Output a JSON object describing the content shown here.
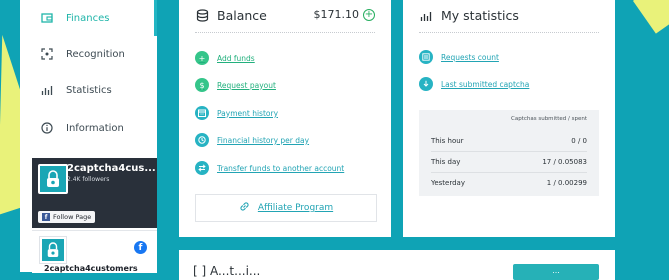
{
  "sidebar": {
    "items": [
      {
        "label": "Finances",
        "icon": "wallet-icon",
        "active": true
      },
      {
        "label": "Recognition",
        "icon": "scan-icon",
        "active": false
      },
      {
        "label": "Statistics",
        "icon": "bar-chart-icon",
        "active": false
      },
      {
        "label": "Information",
        "icon": "info-icon",
        "active": false
      }
    ]
  },
  "facebook": {
    "page_name": "2captcha4cus...",
    "followers": "2.4K followers",
    "follow_label": "Follow Page",
    "page_name_full": "2captcha4customers"
  },
  "balance": {
    "title": "Balance",
    "amount": "$171.10",
    "links": [
      {
        "label": "Add funds",
        "icon": "plus-icon"
      },
      {
        "label": "Request payout",
        "icon": "dollar-icon"
      },
      {
        "label": "Payment history",
        "icon": "calendar-icon"
      },
      {
        "label": "Financial history per day",
        "icon": "history-icon"
      },
      {
        "label": "Transfer funds to another account",
        "icon": "transfer-icon"
      }
    ],
    "affiliate_label": "Affiliate Program"
  },
  "stats": {
    "title": "My statistics",
    "links": [
      {
        "label": "Requests count",
        "icon": "list-icon"
      },
      {
        "label": "Last submitted captcha",
        "icon": "download-icon"
      }
    ],
    "table_title": "Captchas submitted / spent",
    "rows": [
      {
        "period": "This hour",
        "value": "0 / 0"
      },
      {
        "period": "This day",
        "value": "17 / 0.05083"
      },
      {
        "period": "Yesterday",
        "value": "1 / 0.00299"
      }
    ]
  },
  "bottom": {
    "title": "[ ] A...t...i...",
    "button_label": "..."
  },
  "colors": {
    "accent_teal": "#22b6c4",
    "accent_green": "#35c58a",
    "background": "#0fa3b5"
  }
}
